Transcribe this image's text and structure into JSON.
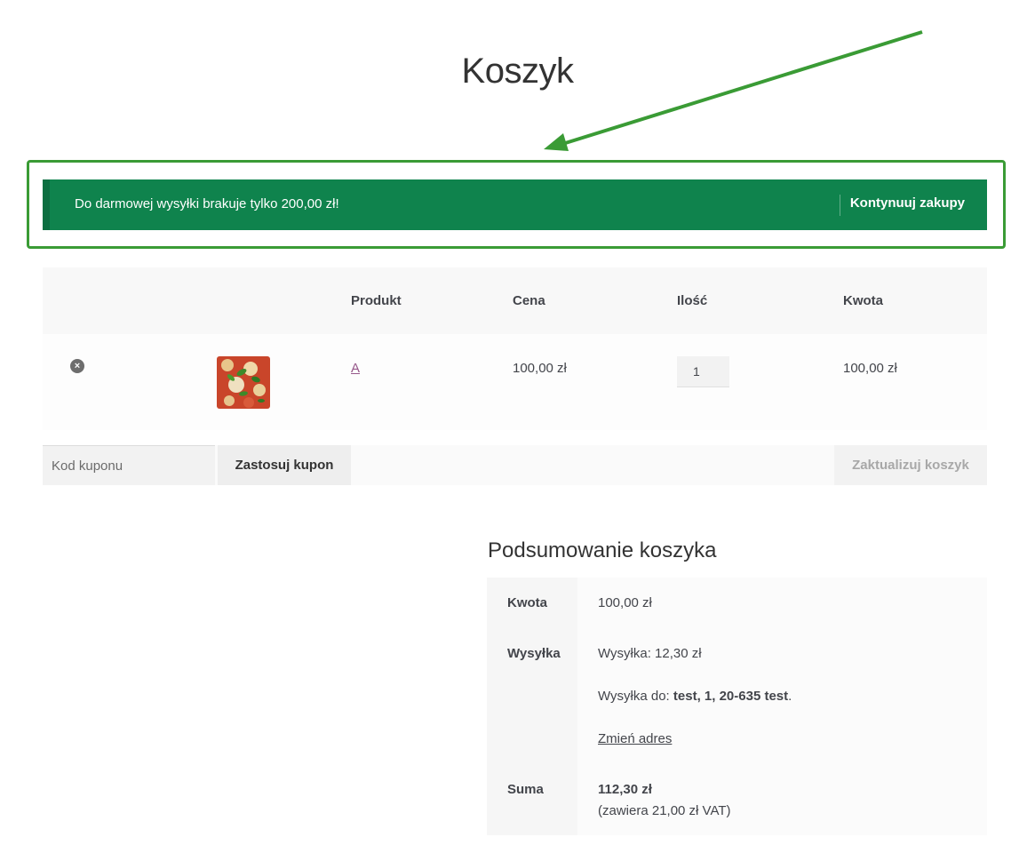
{
  "page": {
    "title": "Koszyk"
  },
  "notice": {
    "message": "Do darmowej wysyłki brakuje tylko 200,00 zł!",
    "button": "Kontynuuj zakupy"
  },
  "colors": {
    "notice_bg": "#0f834d",
    "highlight": "#3a9b35",
    "link": "#96588a"
  },
  "cart": {
    "headers": [
      "Produkt",
      "Cena",
      "Ilość",
      "Kwota"
    ],
    "rows": [
      {
        "product": "A",
        "price": "100,00 zł",
        "qty": "1",
        "subtotal": "100,00 zł",
        "icon": "remove-icon"
      }
    ]
  },
  "coupon": {
    "placeholder": "Kod kuponu",
    "apply": "Zastosuj kupon",
    "update": "Zaktualizuj koszyk"
  },
  "totals": {
    "title": "Podsumowanie koszyka",
    "subtotal_label": "Kwota",
    "subtotal_value": "100,00 zł",
    "shipping_label": "Wysyłka",
    "shipping_value": "Wysyłka: 12,30 zł",
    "shipping_to_prefix": "Wysyłka do:",
    "shipping_to": "test, 1, 20-635 test",
    "shipping_to_suffix": ".",
    "change_address": "Zmień adres",
    "total_label": "Suma",
    "total_value": "112,30 zł",
    "vat_note": "(zawiera 21,00 zł VAT)"
  }
}
